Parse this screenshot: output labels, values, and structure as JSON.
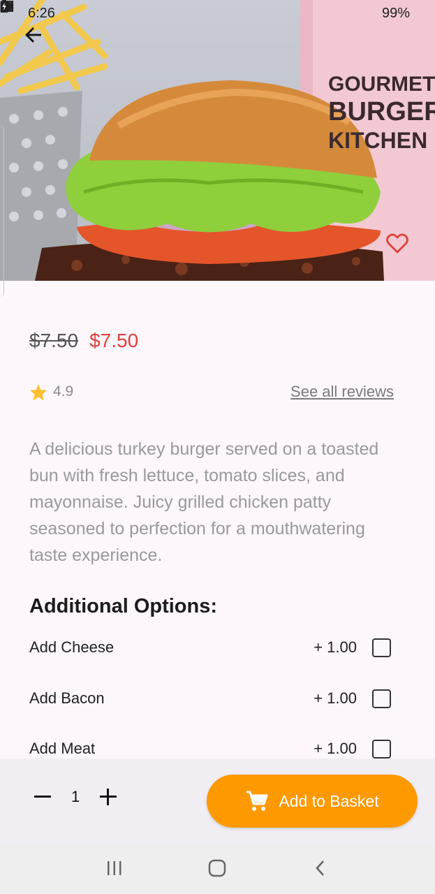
{
  "status_bar": {
    "time": "6:26",
    "battery": "99%",
    "left_icons": [
      "image-icon",
      "wifi-calling-icon"
    ],
    "right_icons": [
      "mute-icon",
      "4g-lte-icon",
      "signal-icon",
      "battery-charging-icon"
    ]
  },
  "hero": {
    "image": "burger-photo",
    "cup_text": [
      "GOURMET",
      "BURGER",
      "KITCHEN"
    ]
  },
  "product": {
    "old_price": "$7.50",
    "price": "$7.50",
    "rating": "4.9",
    "reviews_link": "See all reviews",
    "description": "A delicious turkey burger served on a toasted bun with fresh lettuce, tomato slices, and mayonnaise. Juicy grilled chicken patty seasoned to perfection for a mouthwatering taste experience."
  },
  "options": {
    "title": "Additional Options:",
    "items": [
      {
        "label": "Add Cheese",
        "price": "+ 1.00",
        "checked": false
      },
      {
        "label": "Add Bacon",
        "price": "+ 1.00",
        "checked": false
      },
      {
        "label": "Add Meat",
        "price": "+ 1.00",
        "checked": false
      }
    ]
  },
  "cart": {
    "quantity": "1",
    "add_label": "Add to Basket"
  },
  "colors": {
    "accent": "#fe9900",
    "sale_price": "#e2403a",
    "favorite": "#e2403a",
    "star": "#fbc02d",
    "background": "#fdf6fb"
  }
}
